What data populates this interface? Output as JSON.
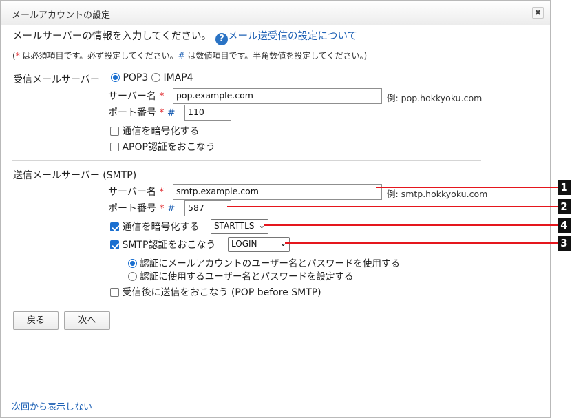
{
  "dialog": {
    "title": "メールアカウントの設定",
    "close_symbol": "✖"
  },
  "intro": {
    "text": "メールサーバーの情報を入力してください。",
    "help_symbol": "?",
    "help_link": "メール送受信の設定について"
  },
  "note": {
    "open": "(",
    "req_mark": "*",
    "req_text": " は必須項目です。必ず設定してください。",
    "num_mark": "#",
    "num_text": " は数値項目です。半角数値を設定してください。)"
  },
  "incoming": {
    "label": "受信メールサーバー",
    "protocol_pop3": "POP3",
    "protocol_imap4": "IMAP4",
    "server_label": "サーバー名",
    "server_value": "pop.example.com",
    "server_hint": "例: pop.hokkyoku.com",
    "port_label": "ポート番号",
    "port_value": "110",
    "encrypt_label": "通信を暗号化する",
    "apop_label": "APOP認証をおこなう"
  },
  "outgoing": {
    "label": "送信メールサーバー (SMTP)",
    "server_label": "サーバー名",
    "server_value": "smtp.example.com",
    "server_hint": "例: smtp.hokkyoku.com",
    "port_label": "ポート番号",
    "port_value": "587",
    "encrypt_label": "通信を暗号化する",
    "encrypt_method": "STARTTLS",
    "auth_label": "SMTP認証をおこなう",
    "auth_method": "LOGIN",
    "auth_option_account": "認証にメールアカウントのユーザー名とパスワードを使用する",
    "auth_option_custom": "認証に使用するユーザー名とパスワードを設定する",
    "pop_before_smtp_label": "受信後に送信をおこなう (POP before SMTP)"
  },
  "marks": {
    "required": "*",
    "numeric": "#",
    "chevron": "⌄"
  },
  "buttons": {
    "back": "戻る",
    "next": "次へ"
  },
  "footer": {
    "dont_show": "次回から表示しない"
  },
  "callouts": [
    "1",
    "2",
    "4",
    "3"
  ]
}
